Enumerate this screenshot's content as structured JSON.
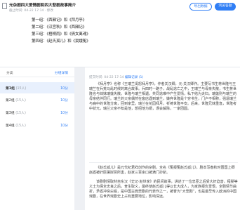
{
  "header": {
    "title": "元杂剧四大爱情剧和四大悲剧故事简介",
    "meta": "截止时间: 04-22 17:14  ·  修改",
    "buttons": {
      "export": "导出数据",
      "browse": "浏览答题"
    },
    "toc": [
      "第一组：《西厢记》和《拜月亭》",
      "第二组：《汉宫秋》和《西厢记》",
      "第三组：《梧桐雨》和《倩女离魂》",
      "第四组：《赵氏孤儿》和《窦娥冤》"
    ]
  },
  "left": {
    "header_label": "分类",
    "settings_link": "分组详情",
    "items": [
      {
        "label": "第1组",
        "count": "(15人)",
        "score": "10分"
      },
      {
        "label": "第2组",
        "count": "(15人)",
        "score": "10分"
      },
      {
        "label": "第3组",
        "count": "(15人)",
        "score": "10分"
      },
      {
        "label": "第4组",
        "count": "(15人)",
        "score": "10分"
      }
    ]
  },
  "right": {
    "meta_prefix": "提交时间: 04-22 17:14",
    "edit_link": "编辑记录 (1)",
    "p1": "《拜月亭》也称《王瑞兰闺怨拜月亭》，作者关汉卿，元·关汉卿作。主要写书生蒋世隆与王瑞兰在兵荒马乱时候的离合故事。兵四时一路子，战乱逃亡之中，王瑞兰与母亲失散，书生蒋世隆也与妹妹瑞莲失散。世隆与瑞兰相遇，共同逃难中产生爱情，私下结为夫妇。瑞莲则与瑞兰的母亲结伴同行。瑞兰的父亲偶然在客店遇到瑞兰，嫌弃世隆是个穷书生，门户不相称，强逼瑞兰与病中的世隆分离，回到家里，瑞兰在花园拜月，祈祷世隆平安。后来，世隆兄妹重逢，世隆考中状元，瑞兰父亲不知是他，想招他为婿，误会解除，一家团圆。",
    "p2": "《赵氏孤儿》是元代纪君祥创作的杂剧，全名《冤报冤赵氏孤儿》，剧本写春秋时晋国上卿赵盾被奸臣屠岸贾所害，赵家三百余口被满门抄斩。",
    "p3": "该剧剧情取材自东汉《史记·赵世家》的民间故事，讲述了一位忠臣之后受大奸迫害，程婴等义士为保全忠良之后，舍生取义，最终使赵氏孤儿得以长大成人，为家族报仇雪恨。全剧情节曲折，矛盾冲突尖锐，是中国古典悲剧的代表作之一，被誉为“大悲剧”，也是最早传入欧洲的中国戏剧，在世界戏剧史上占有重要地位，影响深远。"
  }
}
